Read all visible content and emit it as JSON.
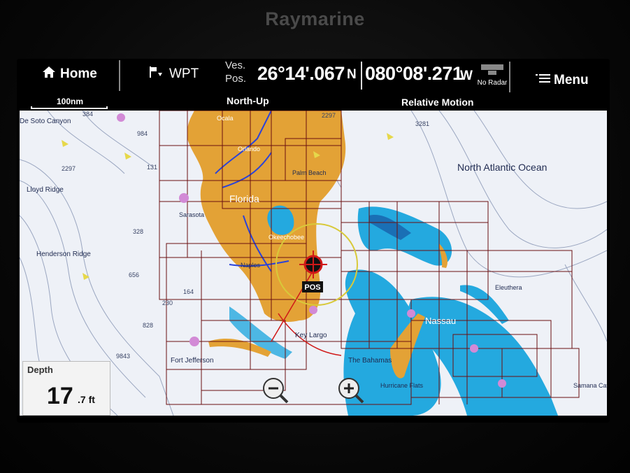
{
  "brand": "Raymarine",
  "topbar": {
    "home_label": "Home",
    "wpt_label": "WPT",
    "vespos_line1": "Ves.",
    "vespos_line2": "Pos.",
    "latitude": "26°14'.067",
    "lat_hemisphere": "N",
    "longitude": "080°08'.271",
    "lon_hemisphere": "W",
    "radar_status": "No Radar",
    "menu_label": "Menu"
  },
  "map": {
    "scale_label": "100nm",
    "orientation": "North-Up",
    "motion_mode": "Relative Motion",
    "labels": {
      "florida": "Florida",
      "atlantic": "North Atlantic Ocean",
      "nassau": "Nassau",
      "bahamas": "The Bahamas",
      "key_largo": "Key Largo",
      "desoto": "De Soto Canyon",
      "lloyd": "Lloyd Ridge",
      "henderson": "Henderson Ridge",
      "fort_jefferson": "Fort Jefferson",
      "ocala": "Ocala",
      "orlando": "Orlando",
      "palm_beach": "Palm Beach",
      "sarasota": "Sarasota",
      "naples": "Naples",
      "okeechobee": "Okeechobee",
      "eleuthera": "Eleuthera",
      "hurricane_flats": "Hurricane Flats",
      "samana_cay": "Samana Cay",
      "pos_marker": "POS"
    },
    "soundings": [
      "384",
      "984",
      "2297",
      "131",
      "328",
      "656",
      "164",
      "230",
      "828",
      "9843",
      "2297",
      "3281"
    ],
    "colors": {
      "land": "#e3a236",
      "deep_water": "#eef1f7",
      "shallow_water": "#24a9df",
      "chart_grid": "#6b1010",
      "river": "#2b43d8",
      "vessel": "#d01818"
    }
  },
  "depth": {
    "label": "Depth",
    "value": "17",
    "unit": ".7 ft"
  },
  "zoom_out_icon": "zoom-out-icon",
  "zoom_in_icon": "zoom-in-icon"
}
